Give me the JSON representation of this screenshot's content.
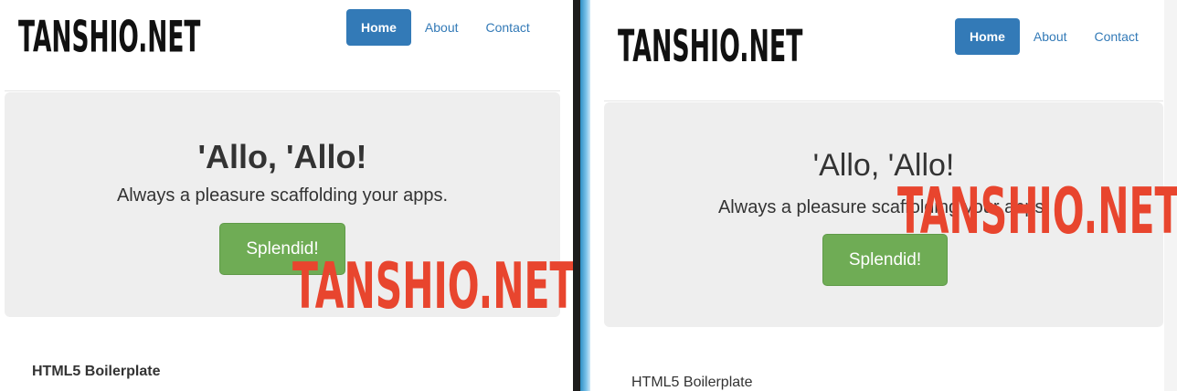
{
  "left": {
    "brand": "TANSHIO.NET",
    "nav": [
      {
        "label": "Home",
        "active": true
      },
      {
        "label": "About",
        "active": false
      },
      {
        "label": "Contact",
        "active": false
      }
    ],
    "jumbotron": {
      "heading": "'Allo, 'Allo!",
      "lead": "Always a pleasure scaffolding your apps.",
      "button": "Splendid!"
    },
    "section_title": "HTML5 Boilerplate"
  },
  "right": {
    "brand": "TANSHIO.NET",
    "nav": [
      {
        "label": "Home",
        "active": true
      },
      {
        "label": "About",
        "active": false
      },
      {
        "label": "Contact",
        "active": false
      }
    ],
    "jumbotron": {
      "heading": "'Allo, 'Allo!",
      "lead": "Always a pleasure scaffolding your apps.",
      "button": "Splendid!"
    },
    "section_title": "HTML5 Boilerplate"
  },
  "watermark": "TANSHIO.NET",
  "colors": {
    "nav_active": "#337ab7",
    "button_success": "#6fac55",
    "watermark": "#e8452e",
    "jumbotron_bg": "#eeeeee"
  }
}
